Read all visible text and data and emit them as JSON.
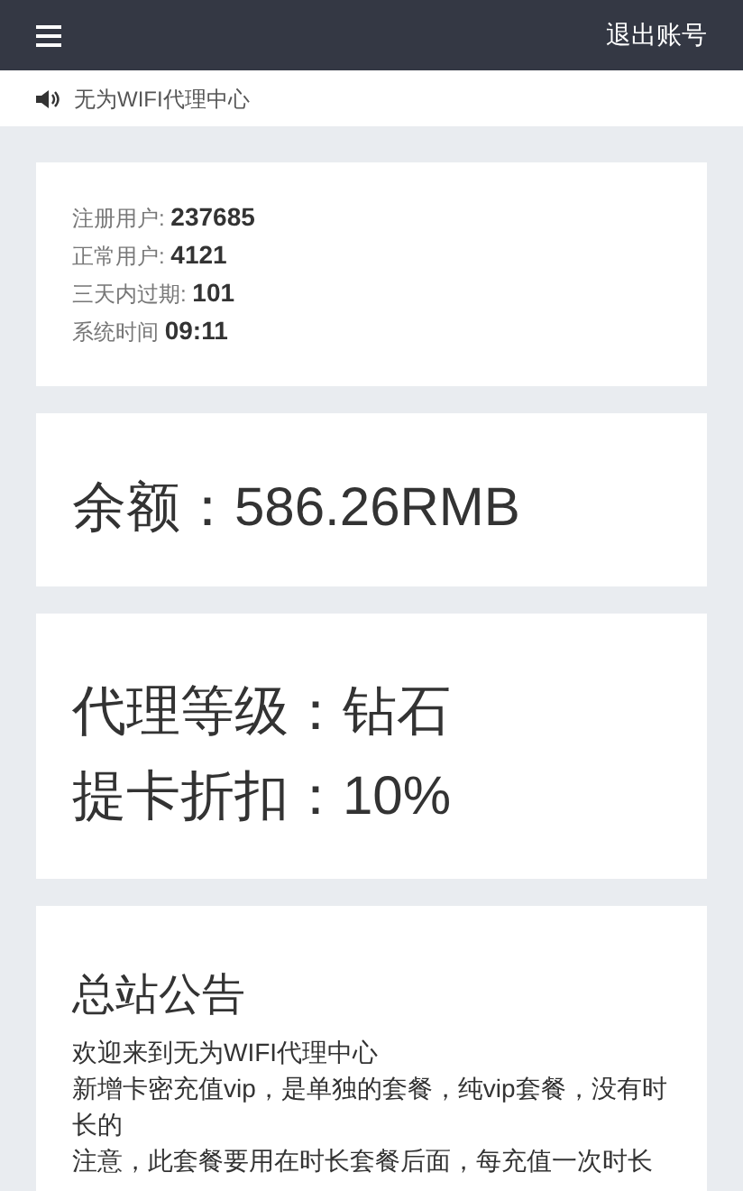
{
  "navbar": {
    "logout": "退出账号"
  },
  "notice": {
    "text": "无为WIFI代理中心"
  },
  "stats": [
    {
      "label": "注册用户:",
      "value": "237685"
    },
    {
      "label": "正常用户:",
      "value": "4121"
    },
    {
      "label": "三天内过期:",
      "value": "101"
    },
    {
      "label": "系统时间",
      "value": "09:11"
    }
  ],
  "balance": {
    "text": "余额：586.26RMB"
  },
  "agent": {
    "lines": [
      "代理等级：钻石",
      "提卡折扣：10%"
    ]
  },
  "announcement": {
    "title": "总站公告",
    "lines": [
      "欢迎来到无为WIFI代理中心",
      "新增卡密充值vip，是单独的套餐，纯vip套餐，没有时长的",
      "注意，此套餐要用在时长套餐后面，每充值一次时长"
    ]
  }
}
